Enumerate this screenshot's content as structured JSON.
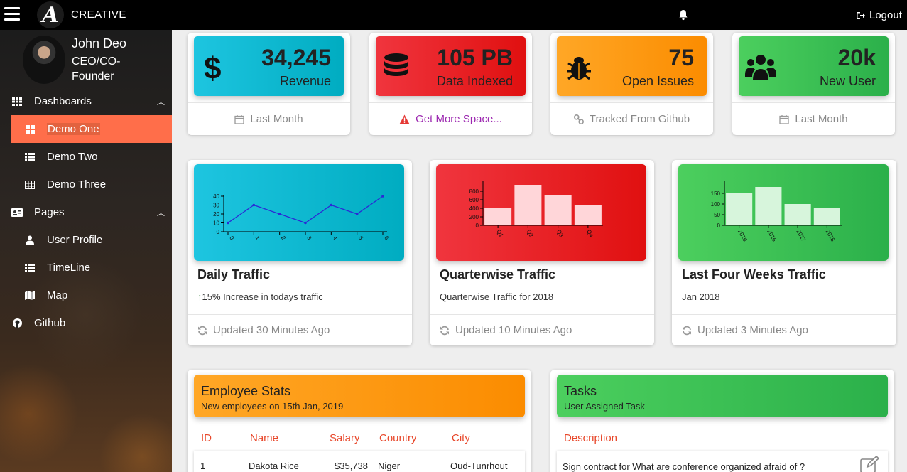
{
  "topbar": {
    "brand": "CREATIVE",
    "logo_letter": "A",
    "logout_label": "Logout"
  },
  "sidebar": {
    "user": {
      "name": "John Deo",
      "role": "CEO/CO-Founder"
    },
    "menu": [
      {
        "label": "Dashboards",
        "icon": "grid-icon"
      },
      {
        "label": "Demo One",
        "icon": "dashboard-icon"
      },
      {
        "label": "Demo Two",
        "icon": "list-icon"
      },
      {
        "label": "Demo Three",
        "icon": "table-icon"
      },
      {
        "label": "Pages",
        "icon": "id-card-icon"
      },
      {
        "label": "User Profile",
        "icon": "user-icon"
      },
      {
        "label": "TimeLine",
        "icon": "list-icon"
      },
      {
        "label": "Map",
        "icon": "map-icon"
      },
      {
        "label": "Github",
        "icon": "github-icon"
      }
    ]
  },
  "stats": [
    {
      "value": "34,245",
      "label": "Revenue",
      "footer": "Last Month",
      "icon": "dollar-icon",
      "color": "#00bcd4"
    },
    {
      "value": "105 PB",
      "label": "Data Indexed",
      "footer": "Get More Space...",
      "icon": "database-icon",
      "color": "#e53935"
    },
    {
      "value": "75",
      "label": "Open Issues",
      "footer": "Tracked From Github",
      "icon": "bug-icon",
      "color": "#ff9800"
    },
    {
      "value": "20k",
      "label": "New User",
      "footer": "Last Month",
      "icon": "users-icon",
      "color": "#4caf50"
    }
  ],
  "charts_text": [
    {
      "title": "Daily Traffic",
      "subtitle": "15% Increase in todays traffic",
      "footer": "Updated 30 Minutes Ago"
    },
    {
      "title": "Quarterwise Traffic",
      "subtitle": "Quarterwise Traffic for 2018",
      "footer": "Updated 10 Minutes Ago"
    },
    {
      "title": "Last Four Weeks Traffic",
      "subtitle": "Jan 2018",
      "footer": "Updated 3 Minutes Ago"
    }
  ],
  "chart_data": [
    {
      "type": "line",
      "x": [
        0,
        1,
        2,
        3,
        4,
        5,
        6
      ],
      "values": [
        10,
        30,
        20,
        10,
        30,
        20,
        40
      ],
      "ylim": [
        0,
        40
      ],
      "yticks": [
        0,
        10,
        20,
        30,
        40
      ],
      "color": "#2a2ad6"
    },
    {
      "type": "bar",
      "categories": [
        "Q1",
        "Q2",
        "Q3",
        "Q4"
      ],
      "values": [
        400,
        950,
        700,
        480
      ],
      "ylim": [
        0,
        1000
      ],
      "yticks": [
        0,
        200,
        400,
        600,
        800
      ],
      "color": "#ffd6d9"
    },
    {
      "type": "bar",
      "categories": [
        "2015",
        "2016",
        "2017",
        "2018"
      ],
      "values": [
        150,
        180,
        100,
        80
      ],
      "ylim": [
        0,
        200
      ],
      "yticks": [
        0,
        50,
        100,
        150
      ],
      "color": "#d7f5dc"
    }
  ],
  "employee_stats": {
    "title": "Employee Stats",
    "subtitle": "New employees on 15th Jan, 2019",
    "columns": [
      "ID",
      "Name",
      "Salary",
      "Country",
      "City"
    ],
    "rows": [
      [
        "1",
        "Dakota Rice",
        "$35,738",
        "Niger",
        "Oud-Tunrhout"
      ]
    ]
  },
  "tasks": {
    "title": "Tasks",
    "subtitle": "User Assigned Task",
    "column": "Description",
    "items": [
      "Sign contract for What are conference organized afraid of ?"
    ]
  }
}
